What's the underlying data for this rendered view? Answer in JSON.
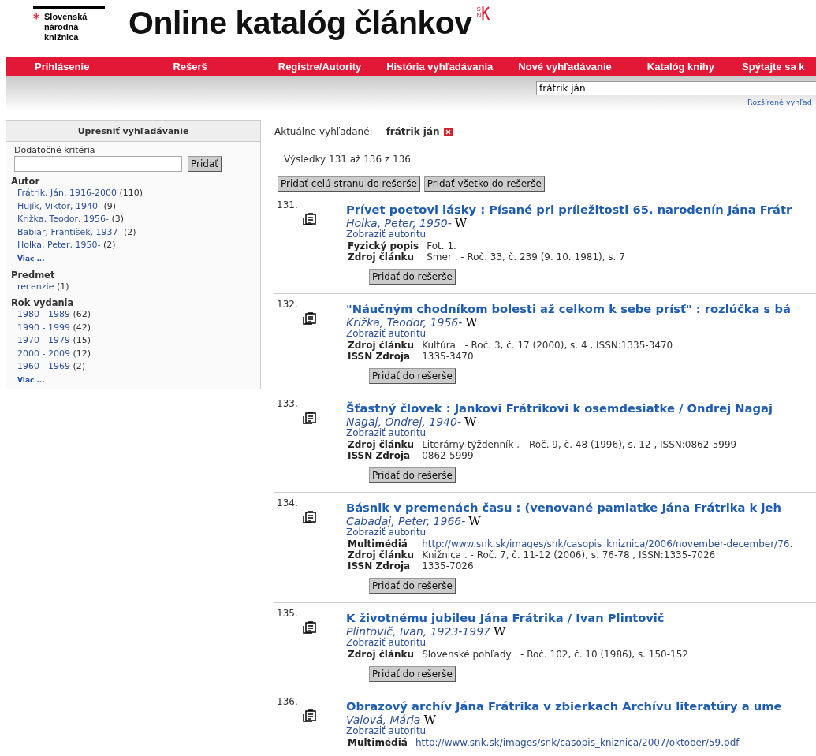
{
  "header": {
    "logo_mark": "*",
    "logo_lines": [
      "Slovenská",
      "národná",
      "knižnica"
    ],
    "title": "Online katalóg článkov",
    "badge_letters": [
      "S",
      "N"
    ]
  },
  "nav": [
    {
      "label": "Prihlásenie"
    },
    {
      "label": "Rešerš"
    },
    {
      "label": "Registre/Autority"
    },
    {
      "label": "História vyhľadávania"
    },
    {
      "label": "Nové vyhľadávanie"
    },
    {
      "label": "Katalóg knihy"
    },
    {
      "label": "Spýtajte sa k"
    }
  ],
  "search": {
    "value": "frátrik ján",
    "advanced_link": "Rozšírené vyhľad"
  },
  "sidebar": {
    "title": "Upresniť vyhľadávanie",
    "criteria_label": "Dodatočné kritéria",
    "add_button": "Pridať",
    "groups": [
      {
        "heading": "Autor",
        "items": [
          {
            "label": "Frátrik, Ján, 1916-2000",
            "count": "(110)"
          },
          {
            "label": "Hujík, Viktor, 1940-",
            "count": "(9)"
          },
          {
            "label": "Križka, Teodor, 1956-",
            "count": "(3)"
          },
          {
            "label": "Babiar, František, 1937-",
            "count": "(2)"
          },
          {
            "label": "Holka, Peter, 1950-",
            "count": "(2)"
          }
        ],
        "more": "Viac ..."
      },
      {
        "heading": "Predmet",
        "items": [
          {
            "label": "recenzie",
            "count": "(1)"
          }
        ]
      },
      {
        "heading": "Rok vydania",
        "items": [
          {
            "label": "1980 - 1989",
            "count": "(62)"
          },
          {
            "label": "1990 - 1999",
            "count": "(42)"
          },
          {
            "label": "1970 - 1979",
            "count": "(15)"
          },
          {
            "label": "2000 - 2009",
            "count": "(12)"
          },
          {
            "label": "1960 - 1969",
            "count": "(2)"
          }
        ],
        "more": "Viac ..."
      }
    ]
  },
  "current": {
    "label": "Aktuálne vyhľadané:",
    "term": "frátrik ján"
  },
  "results_summary": "Výsledky 131 až 136 z 136",
  "bulk_buttons": [
    "Pridať celú stranu do rešerše",
    "Pridať všetko do rešerše"
  ],
  "results": [
    {
      "number": "131.",
      "title": "Prívet poetovi lásky : Písané pri príležitosti 65. narodenín Jána Frátr",
      "author": "Holka, Peter, 1950-",
      "wiki": "W",
      "authority_link": "Zobraziť autoritu",
      "fields": [
        {
          "label": "Fyzický popis",
          "value": "Fot. 1.",
          "kind": "text"
        },
        {
          "label": "Zdroj článku",
          "value": "Smer . - Roč. 33, č. 239 (9. 10. 1981), s. 7",
          "kind": "text"
        }
      ],
      "button": "Pridať do rešerše"
    },
    {
      "number": "132.",
      "title": "\"Náučným chodníkom bolesti až celkom k sebe prísť\" : rozlúčka s bá",
      "author": "Križka, Teodor, 1956-",
      "wiki": "W",
      "authority_link": "Zobraziť autoritu",
      "fields": [
        {
          "label": "Zdroj článku",
          "value": "Kultúra . - Roč. 3, č. 17 (2000), s. 4 , ISSN:1335-3470",
          "kind": "text"
        },
        {
          "label": "ISSN Zdroja",
          "value": "1335-3470",
          "kind": "text"
        }
      ],
      "button": "Pridať do rešerše"
    },
    {
      "number": "133.",
      "title": "Šťastný človek : Jankovi Frátrikovi k osemdesiatke / Ondrej Nagaj",
      "author": "Nagaj, Ondrej, 1940-",
      "wiki": "W",
      "authority_link": "Zobraziť autoritu",
      "fields": [
        {
          "label": "Zdroj článku",
          "value": "Literárny týždenník . - Roč. 9, č. 48 (1996), s. 12 , ISSN:0862-5999",
          "kind": "text"
        },
        {
          "label": "ISSN Zdroja",
          "value": "0862-5999",
          "kind": "text"
        }
      ],
      "button": "Pridať do rešerše"
    },
    {
      "number": "134.",
      "title": "Básnik v premenách času : (venované pamiatke Jána Frátrika k jeh",
      "author": "Cabadaj, Peter, 1966-",
      "wiki": "W",
      "authority_link": "Zobraziť autoritu",
      "fields": [
        {
          "label": "Multimédiá",
          "value": "http://www.snk.sk/images/snk/casopis_kniznica/2006/november-december/76.",
          "kind": "link"
        },
        {
          "label": "Zdroj článku",
          "value": "Knižnica . - Roč. 7, č. 11-12 (2006), s. 76-78 , ISSN:1335-7026",
          "kind": "text"
        },
        {
          "label": "ISSN Zdroja",
          "value": "1335-7026",
          "kind": "text"
        }
      ],
      "button": "Pridať do rešerše"
    },
    {
      "number": "135.",
      "title": "K životnému jubileu Jána Frátrika / Ivan Plintovič",
      "author": "Plintovič, Ivan, 1923-1997",
      "wiki": "W",
      "authority_link": "Zobraziť autoritu",
      "fields": [
        {
          "label": "Zdroj článku",
          "value": "Slovenské pohľady . - Roč. 102, č. 10 (1986), s. 150-152",
          "kind": "text"
        }
      ],
      "button": "Pridať do rešerše"
    },
    {
      "number": "136.",
      "title": "Obrazový archív Jána Frátrika v zbierkach Archívu literatúry a ume",
      "author": "Valová, Mária",
      "wiki": "W",
      "authority_link": "Zobraziť autoritu",
      "fields": [
        {
          "label": "Multimédiá",
          "value": "http://www.snk.sk/images/snk/casopis_kniznica/2007/oktober/59.pdf",
          "kind": "link"
        }
      ]
    }
  ]
}
